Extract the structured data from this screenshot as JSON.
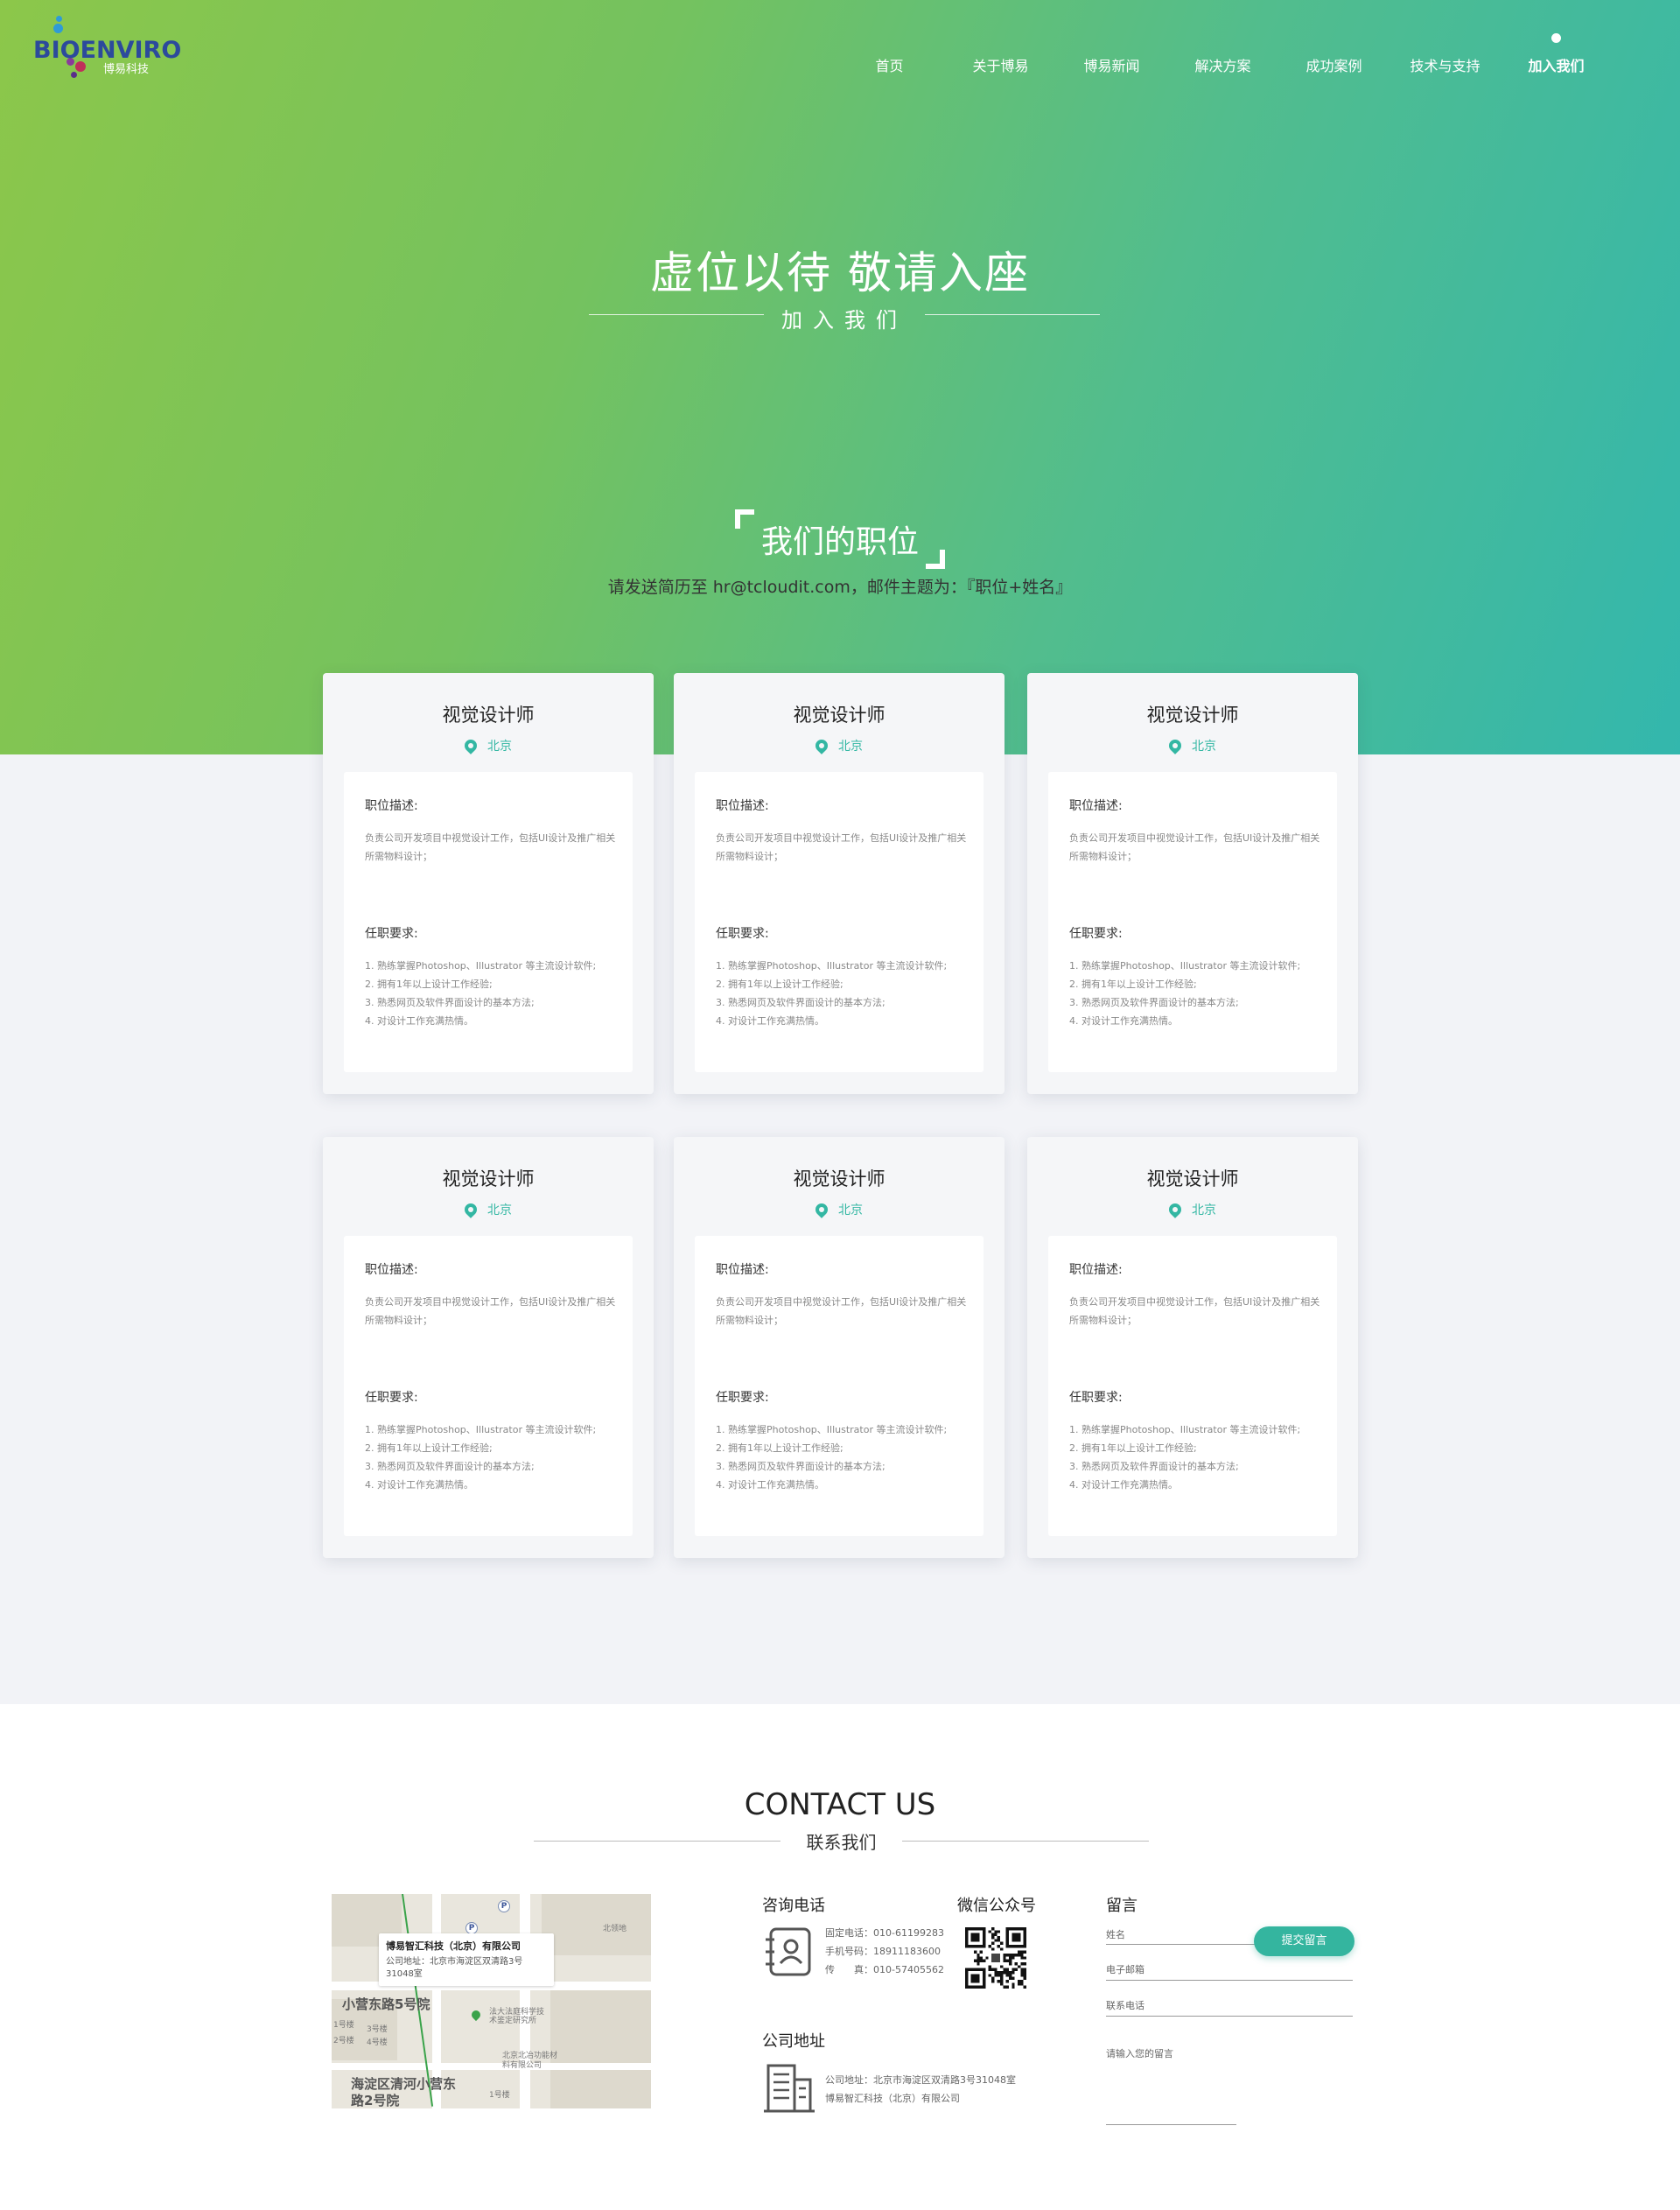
{
  "brand": {
    "logo_text": "BIOENVIRO",
    "logo_sub": "博易科技"
  },
  "nav": {
    "items": [
      {
        "label": "首页"
      },
      {
        "label": "关于博易"
      },
      {
        "label": "博易新闻"
      },
      {
        "label": "解决方案"
      },
      {
        "label": "成功案例"
      },
      {
        "label": "技术与支持"
      },
      {
        "label": "加入我们"
      }
    ],
    "active": "加入我们"
  },
  "hero": {
    "title": "虚位以待 敬请入座",
    "subtitle": "加入我们"
  },
  "positions": {
    "title": "我们的职位",
    "desc": "请发送简历至 hr@tcloudit.com，邮件主题为：『职位+姓名』",
    "cards": [
      {
        "title": "视觉设计师",
        "location": "北京",
        "desc_label": "职位描述:",
        "desc": "负责公司开发项目中视觉设计工作，包括UI设计及推广相关所需物料设计；",
        "req_label": "任职要求:",
        "reqs": [
          "1. 熟练掌握Photoshop、Illustrator 等主流设计软件;",
          "2. 拥有1年以上设计工作经验;",
          "3. 熟悉网页及软件界面设计的基本方法;",
          "4. 对设计工作充满热情。"
        ]
      },
      {
        "title": "视觉设计师",
        "location": "北京",
        "desc_label": "职位描述:",
        "desc": "负责公司开发项目中视觉设计工作，包括UI设计及推广相关所需物料设计；",
        "req_label": "任职要求:",
        "reqs": [
          "1. 熟练掌握Photoshop、Illustrator 等主流设计软件;",
          "2. 拥有1年以上设计工作经验;",
          "3. 熟悉网页及软件界面设计的基本方法;",
          "4. 对设计工作充满热情。"
        ]
      },
      {
        "title": "视觉设计师",
        "location": "北京",
        "desc_label": "职位描述:",
        "desc": "负责公司开发项目中视觉设计工作，包括UI设计及推广相关所需物料设计；",
        "req_label": "任职要求:",
        "reqs": [
          "1. 熟练掌握Photoshop、Illustrator 等主流设计软件;",
          "2. 拥有1年以上设计工作经验;",
          "3. 熟悉网页及软件界面设计的基本方法;",
          "4. 对设计工作充满热情。"
        ]
      },
      {
        "title": "视觉设计师",
        "location": "北京",
        "desc_label": "职位描述:",
        "desc": "负责公司开发项目中视觉设计工作，包括UI设计及推广相关所需物料设计；",
        "req_label": "任职要求:",
        "reqs": [
          "1. 熟练掌握Photoshop、Illustrator 等主流设计软件;",
          "2. 拥有1年以上设计工作经验;",
          "3. 熟悉网页及软件界面设计的基本方法;",
          "4. 对设计工作充满热情。"
        ]
      },
      {
        "title": "视觉设计师",
        "location": "北京",
        "desc_label": "职位描述:",
        "desc": "负责公司开发项目中视觉设计工作，包括UI设计及推广相关所需物料设计；",
        "req_label": "任职要求:",
        "reqs": [
          "1. 熟练掌握Photoshop、Illustrator 等主流设计软件;",
          "2. 拥有1年以上设计工作经验;",
          "3. 熟悉网页及软件界面设计的基本方法;",
          "4. 对设计工作充满热情。"
        ]
      },
      {
        "title": "视觉设计师",
        "location": "北京",
        "desc_label": "职位描述:",
        "desc": "负责公司开发项目中视觉设计工作，包括UI设计及推广相关所需物料设计；",
        "req_label": "任职要求:",
        "reqs": [
          "1. 熟练掌握Photoshop、Illustrator 等主流设计软件;",
          "2. 拥有1年以上设计工作经验;",
          "3. 熟悉网页及软件界面设计的基本方法;",
          "4. 对设计工作充满热情。"
        ]
      }
    ]
  },
  "contact": {
    "title": "CONTACT US",
    "subtitle": "联系我们",
    "map": {
      "popup_title": "博易智汇科技（北京）有限公司",
      "popup_addr": "公司地址：北京市海淀区双清路3号31048室",
      "label_1": "小营东路5号院",
      "label_2": "海淀区清河小营东路2号院",
      "label_3": "法大法庭科学技术鉴定研究所",
      "label_4": "北京北冶功能材料有限公司",
      "label_5": "北领地",
      "label_6": "1号楼",
      "label_7": "3号楼",
      "label_8": "2号楼",
      "label_9": "4号楼",
      "label_10": "1号楼",
      "p_label": "P"
    },
    "phone": {
      "title": "咨询电话",
      "lines": [
        "固定电话：010-61199283",
        "手机号码：18911183600",
        "传　　真：010-57405562"
      ]
    },
    "wechat": {
      "title": "微信公众号"
    },
    "address": {
      "title": "公司地址",
      "lines": [
        "公司地址：北京市海淀区双清路3号31048室",
        "博易智汇科技（北京）有限公司"
      ]
    },
    "message": {
      "title": "留言",
      "name_placeholder": "姓名",
      "email_placeholder": "电子邮箱",
      "phone_placeholder": "联系电话",
      "message_placeholder": "请输入您的留言",
      "submit_label": "提交留言"
    }
  },
  "colors": {
    "accent": "#33b7a3",
    "hero_start": "#8cc74a",
    "hero_end": "#33b7ad",
    "brand_blue": "#2c4a9c"
  },
  "icons": {
    "location": "map-pin-icon",
    "phone": "contact-card-icon",
    "address": "building-icon"
  }
}
